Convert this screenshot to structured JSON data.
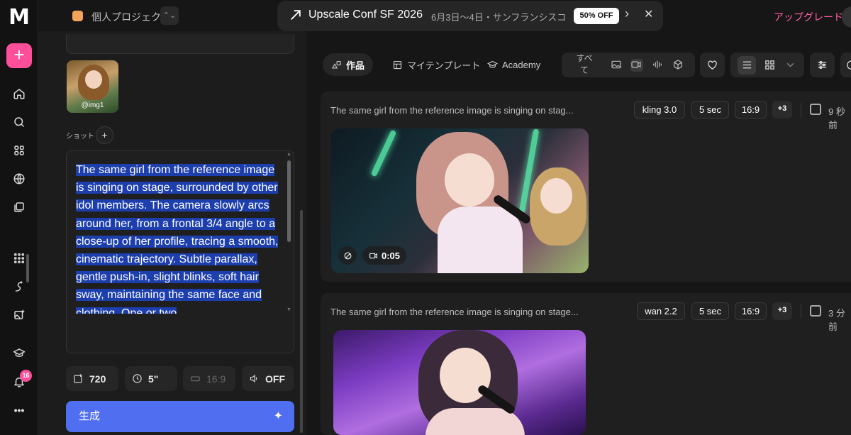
{
  "nav": {
    "logo": "M",
    "create_label": "+",
    "notifications_count": "16",
    "more_label": "•••",
    "icons": [
      "home-icon",
      "search-icon",
      "apps-icon",
      "globe-icon",
      "library-icon",
      "grid-icon",
      "brush-icon",
      "image-edit-icon",
      "academy-icon",
      "bell-icon",
      "more-icon"
    ]
  },
  "project": {
    "name": "個人プロジェクト",
    "switch_label": "⌃⌄"
  },
  "banner": {
    "title": "Upscale Conf SF 2026",
    "subtitle": "6月3日〜4日・サンフランシスコ",
    "pill": "50% OFF",
    "next_label": "›",
    "close_label": "✕"
  },
  "header": {
    "upgrade_label": "アップグレード"
  },
  "editor": {
    "reference_label": "@img1",
    "shot_label": "ショット",
    "shot_add_label": "+",
    "prompt_text": "The same girl from the reference image is singing on stage, surrounded by other idol members. The camera slowly arcs around her, from a frontal 3/4 angle to a close-up of her profile, tracing a smooth, cinematic trajectory. Subtle parallax, gentle push-in, slight blinks, soft hair sway, maintaining the same face and clothing. One or two",
    "options": {
      "resolution": "720",
      "duration": "5\"",
      "aspect": "16:9",
      "sound": "OFF"
    },
    "generate_label": "生成",
    "generate_icon": "sparkle-icon"
  },
  "tabs": {
    "works": "作品",
    "my_templates": "マイテンプレート",
    "academy": "Academy",
    "filter_all": "すべて"
  },
  "results": [
    {
      "prompt": "The same girl from the reference image is singing on stag...",
      "model": "kling 3.0",
      "duration": "5 sec",
      "aspect": "16:9",
      "more": "+3",
      "time": "9 秒前",
      "video_duration": "0:05"
    },
    {
      "prompt": "The same girl from the reference image is singing on stage...",
      "model": "wan 2.2",
      "duration": "5 sec",
      "aspect": "16:9",
      "more": "+3",
      "time": "3 分前"
    }
  ],
  "colors": {
    "accent_pink": "#ff4f9a",
    "generate_blue": "#4f6ef0",
    "selection_blue": "#1d3fae",
    "upgrade_pink": "#ff5fa8"
  }
}
